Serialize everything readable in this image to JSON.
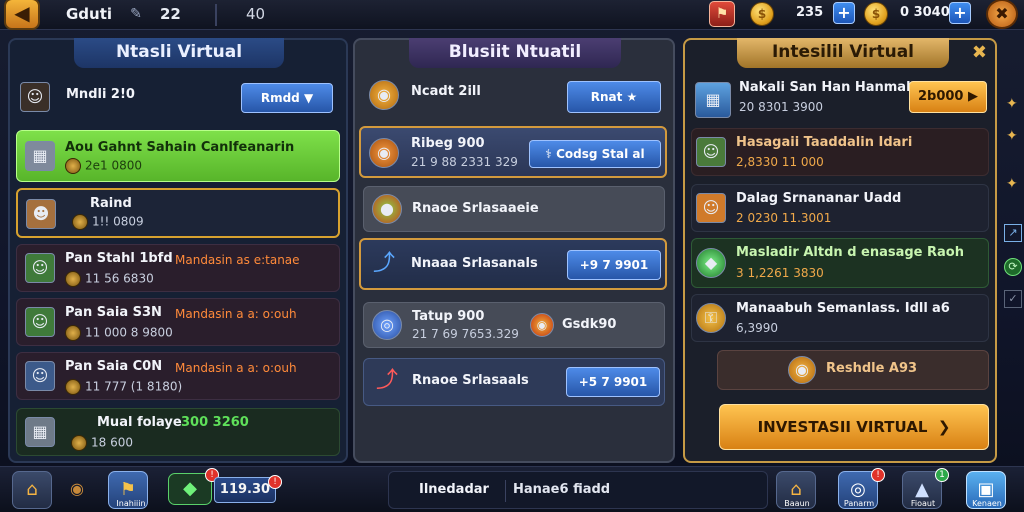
{
  "top": {
    "back_icon": "back-arrow-icon",
    "title": "Gduti",
    "num1": "22",
    "num2": "40",
    "currency1": "235",
    "currency2": "0 3040"
  },
  "panel1": {
    "title": "Ntasli Virtual",
    "header": {
      "name": "Mndli 2!0",
      "button": "Rmdd"
    },
    "rows": [
      {
        "name": "Aou Gahnt Sahain Canlfeanarin",
        "sub": "2e1 0800"
      },
      {
        "name": "Raind",
        "sub": "1!! 0809"
      },
      {
        "name": "Pan Stahl 1bfd",
        "sub": "11 56 6830",
        "tag": "Mandasin as e:tanae"
      },
      {
        "name": "Pan Saia S3N",
        "sub": "11 000 8 9800",
        "tag": "Mandasin a a: o:ouh"
      },
      {
        "name": "Pan Saia C0N",
        "sub": "11 777 (1 8180)",
        "tag": "Mandasin a a: o:ouh"
      },
      {
        "name": "Mual folaye",
        "sub": "18 600",
        "value": "300 3260"
      }
    ]
  },
  "panel2": {
    "title": "Blusiit Ntuatil",
    "header": {
      "name": "Ncadt 2ill",
      "button": "Rnat"
    },
    "rows": [
      {
        "name": "Ribeg 900",
        "sub": "21 9 88 2331 329",
        "button": "Codsg Stal al"
      },
      {
        "name": "Rnaoe Srlasaaeie"
      },
      {
        "name": "Nnaaa Srlasanals",
        "button": "+9 7 9901"
      },
      {
        "name": "Tatup 900",
        "sub": "21 7 69 7653.329",
        "tag": "Gsdk90"
      },
      {
        "name": "Rnaoe Srlasaals",
        "button": "+5 7 9901"
      }
    ]
  },
  "panel3": {
    "title": "Intesilil Virtual",
    "header": {
      "name": "Nakali San Han Hanmal",
      "sub": "20 8301 3900",
      "button": "2b000"
    },
    "rows": [
      {
        "name": "Hasagaii Taaddalin Idari",
        "sub": "2,8330 11 000"
      },
      {
        "name": "Dalag Srnananar Uadd",
        "sub": "2 0230 11.3001"
      },
      {
        "name": "Masladir Altdn d enasage Raoh",
        "sub": "3 1,2261 3830"
      },
      {
        "name": "Manaabuh Semanlass. Idll",
        "sub": "6,3990",
        "tag": "a6"
      }
    ],
    "restore_btn": "Reshdle A93",
    "invest_btn": "INVESTASII VIRTUAL"
  },
  "bottom": {
    "label1": "Inahiiin",
    "value": "119.30",
    "tab1": "Ilnedadar",
    "tab2": "Hanae6 fiadd",
    "labels": [
      "Baaun",
      "Panarm",
      "Fioaut",
      "Kenaen"
    ]
  },
  "colors": {
    "accent_green": "#7ed957",
    "accent_gold": "#f2b33d",
    "accent_blue": "#3f7fe0",
    "tag_orange": "#ff8a3a"
  }
}
